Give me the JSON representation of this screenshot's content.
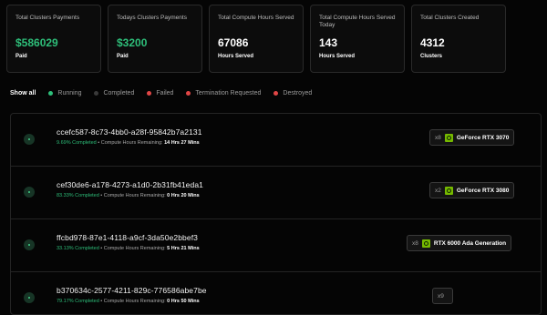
{
  "stats": [
    {
      "label": "Total Clusters Payments",
      "value": "$586029",
      "sub": "Paid",
      "green": true
    },
    {
      "label": "Todays Clusters Payments",
      "value": "$3200",
      "sub": "Paid",
      "green": true
    },
    {
      "label": "Total Compute Hours Served",
      "value": "67086",
      "sub": "Hours Served",
      "green": false
    },
    {
      "label": "Total Compute Hours Served Today",
      "value": "143",
      "sub": "Hours Served",
      "green": false
    },
    {
      "label": "Total Clusters Created",
      "value": "4312",
      "sub": "Clusters",
      "green": false
    }
  ],
  "filters": [
    {
      "label": "Show all",
      "color": null
    },
    {
      "label": "Running",
      "color": "#2ebf7a"
    },
    {
      "label": "Completed",
      "color": "#3a3a3a"
    },
    {
      "label": "Failed",
      "color": "#e04646"
    },
    {
      "label": "Termination Requested",
      "color": "#e04646"
    },
    {
      "label": "Destroyed",
      "color": "#e04646"
    }
  ],
  "clusters": [
    {
      "id": "ccefc587-8c73-4bb0-a28f-95842b7a2131",
      "percent": "9.69% Completed",
      "remaining_label": " • Compute Hours Remaining:",
      "remaining": "14 Hrs 27 Mins",
      "count": "x8",
      "gpu": "GeForce RTX 3070"
    },
    {
      "id": "cef30de6-a178-4273-a1d0-2b31fb41eda1",
      "percent": "83.33% Completed",
      "remaining_label": " • Compute Hours Remaining:",
      "remaining": "0 Hrs 20 Mins",
      "count": "x2",
      "gpu": "GeForce RTX 3080"
    },
    {
      "id": "ffcbd978-87e1-4118-a9cf-3da50e2bbef3",
      "percent": "33.13% Completed",
      "remaining_label": " • Compute Hours Remaining:",
      "remaining": "5 Hrs 21 Mins",
      "count": "x8",
      "gpu": "RTX 6000 Ada Generation"
    },
    {
      "id": "b370634c-2577-4211-829c-776586abe7be",
      "percent": "79.17% Completed",
      "remaining_label": " • Compute Hours Remaining:",
      "remaining": "0 Hrs 50 Mins",
      "count": "x9",
      "gpu": ""
    }
  ]
}
